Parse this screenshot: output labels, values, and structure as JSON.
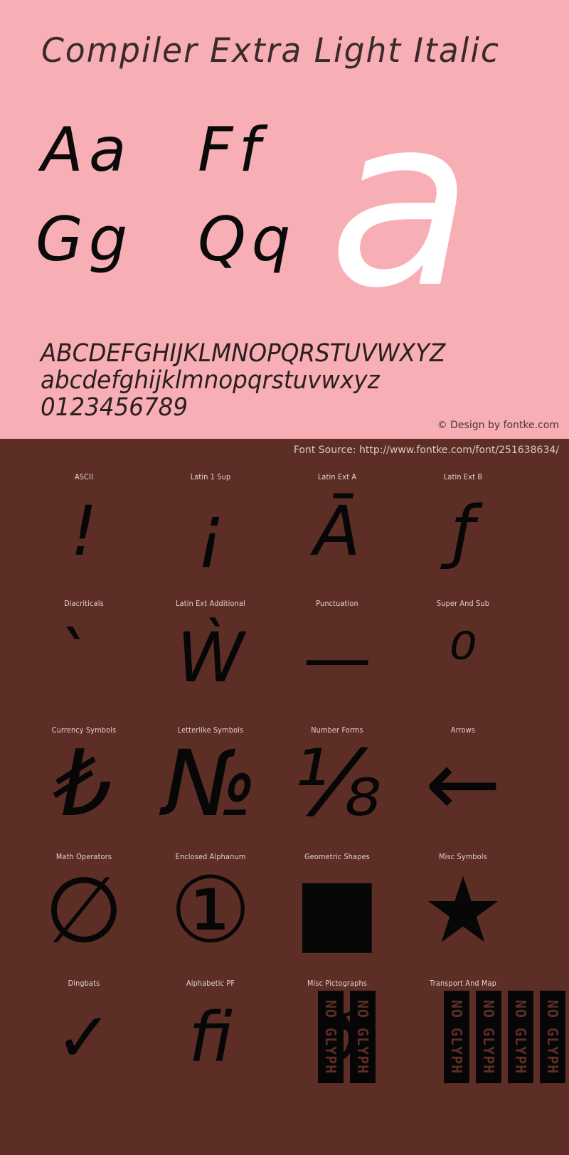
{
  "colors": {
    "hero_bg": "#F7AEB4",
    "blocks_bg": "#5C2E26",
    "hero_text": "#3A2B2B",
    "glyph_black": "#0A0A0A",
    "glyph_white": "#FFFFFF",
    "label_text": "#E3D2CF"
  },
  "hero": {
    "title": "Compiler Extra Light Italic",
    "letter_pairs": [
      "Aa",
      "Ff",
      "Gg",
      "Qq"
    ],
    "feature_glyph": "a",
    "alphabet_upper": "ABCDEFGHIJKLMNOPQRSTUVWXYZ",
    "alphabet_lower": "abcdefghijklmnopqrstuvwxyz",
    "digits": "0123456789",
    "credit": "© Design by fontke.com"
  },
  "blocks": {
    "source": "Font Source: http://www.fontke.com/font/251638634/",
    "rows": [
      [
        {
          "label": "ASCII",
          "sample": "!",
          "noglyph": 0
        },
        {
          "label": "Latin 1 Sup",
          "sample": "¡",
          "noglyph": 0
        },
        {
          "label": "Latin Ext A",
          "sample": "Ā",
          "noglyph": 0
        },
        {
          "label": "Latin Ext B",
          "sample": "ƒ",
          "noglyph": 0
        }
      ],
      [
        {
          "label": "Diacriticals",
          "sample": "̀",
          "noglyph": 0
        },
        {
          "label": "Latin Ext Additional",
          "sample": "Ẁ",
          "noglyph": 0
        },
        {
          "label": "Punctuation",
          "sample": "—",
          "noglyph": 0
        },
        {
          "label": "Super And Sub",
          "sample": "⁰",
          "noglyph": 0
        }
      ],
      [
        {
          "label": "Currency Symbols",
          "sample": "₺",
          "noglyph": 0
        },
        {
          "label": "Letterlike Symbols",
          "sample": "№",
          "noglyph": 0
        },
        {
          "label": "Number Forms",
          "sample": "⅛",
          "noglyph": 0
        },
        {
          "label": "Arrows",
          "sample": "←",
          "noglyph": 0
        }
      ],
      [
        {
          "label": "Math Operators",
          "sample": "∅",
          "noglyph": 0
        },
        {
          "label": "Enclosed Alphanum",
          "sample": "①",
          "noglyph": 0
        },
        {
          "label": "Geometric Shapes",
          "sample": "■",
          "noglyph": 0
        },
        {
          "label": "Misc Symbols",
          "sample": "★",
          "noglyph": 0
        }
      ],
      [
        {
          "label": "Dingbats",
          "sample": "✓",
          "noglyph": 0
        },
        {
          "label": "Alphabetic PF",
          "sample": "ﬁ",
          "noglyph": 0
        },
        {
          "label": "Misc Pictographs",
          "sample": "ð",
          "noglyph": 2
        },
        {
          "label": "Transport And Map",
          "sample": "",
          "noglyph": 4
        }
      ]
    ],
    "noglyph_text": "NO GLYPH"
  }
}
